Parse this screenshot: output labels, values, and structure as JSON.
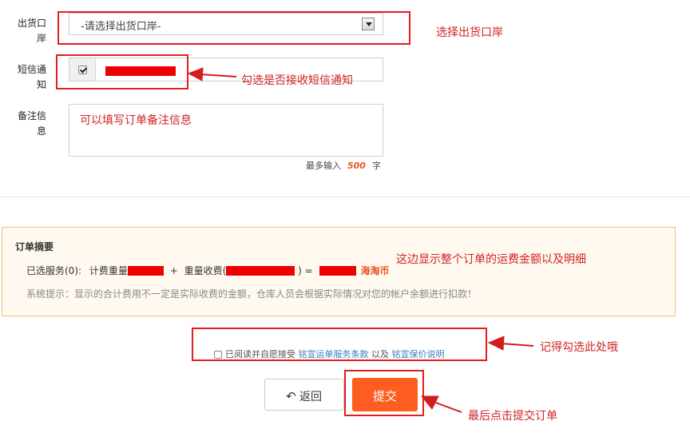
{
  "form": {
    "port_label": "出货口岸",
    "port_select_value": "-请选择出货口岸-",
    "sms_label": "短信通知",
    "remark_label": "备注信息",
    "remark_placeholder": "可以填写订单备注信息",
    "max_input_prefix": "最多输入",
    "max_input_value": "500",
    "max_input_suffix": "字"
  },
  "summary": {
    "title": "订单摘要",
    "selected_services": "已选服务(0):",
    "weight_fee_label": "计费重量",
    "plus": "+",
    "weight_charge_label": "重量收费(",
    "close_paren_equals": ") =",
    "currency": "海淘币",
    "tip": "系统提示：显示的合计费用不一定是实际收费的金额，仓库人员会根据实际情况对您的帐户余额进行扣款！"
  },
  "agreement": {
    "prefix": "已阅读并自愿接受",
    "link1": "铭宣运单服务条款",
    "middle": "以及",
    "link2": "铭宣保价说明"
  },
  "buttons": {
    "back": "返回",
    "back_icon": "undo-arrow-icon",
    "submit": "提交"
  },
  "annotations": {
    "select_port": "选择出货口岸",
    "sms_tip": "勾选是否接收短信通知",
    "summary_tip": "这边显示整个订单的运费金额以及明细",
    "agree_tip": "记得勾选此处哦",
    "submit_tip": "最后点击提交订单"
  },
  "colors": {
    "accent": "#fd5d1e",
    "annotation_red": "#e51d1d",
    "link": "#3a7fc1",
    "summary_bg": "#fff9ef"
  },
  "state": {
    "sms_checked": true,
    "agreement_checked": false
  }
}
